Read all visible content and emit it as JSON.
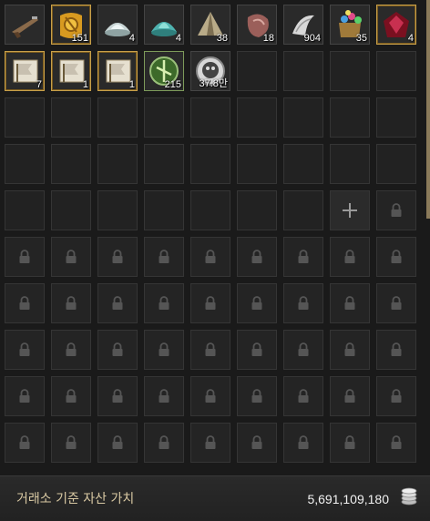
{
  "inventory": {
    "items": [
      {
        "name": "flintlock-gun-icon",
        "count": "",
        "frame": "normal"
      },
      {
        "name": "gold-scroll-icon",
        "count": "151",
        "frame": "gold"
      },
      {
        "name": "silver-ore-icon",
        "count": "4",
        "frame": "normal"
      },
      {
        "name": "teal-ore-icon",
        "count": "4",
        "frame": "normal"
      },
      {
        "name": "tent-icon",
        "count": "38",
        "frame": "normal"
      },
      {
        "name": "meat-icon",
        "count": "18",
        "frame": "normal"
      },
      {
        "name": "claw-icon",
        "count": "904",
        "frame": "normal"
      },
      {
        "name": "gem-pouch-icon",
        "count": "35",
        "frame": "normal"
      },
      {
        "name": "red-crystal-icon",
        "count": "4",
        "frame": "gold"
      },
      {
        "name": "flag-scroll-icon",
        "count": "7",
        "frame": "gold"
      },
      {
        "name": "flag-scroll-icon",
        "count": "1",
        "frame": "gold"
      },
      {
        "name": "flag-scroll-icon",
        "count": "1",
        "frame": "gold"
      },
      {
        "name": "green-emblem-icon",
        "count": "215",
        "frame": "green"
      },
      {
        "name": "skull-coin-icon",
        "count": "37.8만",
        "frame": "normal"
      }
    ],
    "empty_unlocked_slots": 29,
    "add_slot_present": true,
    "locked_slots": 46
  },
  "footer": {
    "label": "거래소 기준 자산 가치",
    "value": "5,691,109,180",
    "icon": "silver-coin-stack-icon"
  },
  "colors": {
    "gold_frame": "#c8a04a",
    "green_frame": "#7d9a5a",
    "footer_label": "#d9c9a3"
  }
}
